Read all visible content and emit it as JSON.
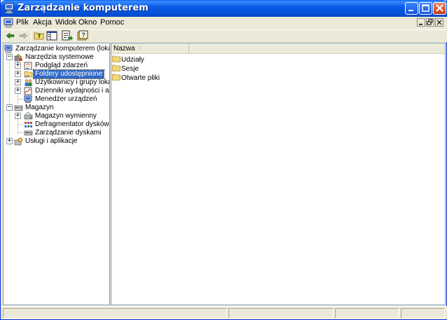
{
  "window": {
    "title": "Zarządzanie komputerem"
  },
  "menu": {
    "items": [
      "Plik",
      "Akcja",
      "Widok",
      "Okno",
      "Pomoc"
    ]
  },
  "toolbar": {
    "buttons": [
      "back-arrow-icon",
      "forward-arrow-icon",
      "up-folder-icon",
      "show-hide-tree-icon",
      "export-list-icon",
      "help-icon"
    ]
  },
  "tree": {
    "root": "Zarządzanie komputerem (lokalne)",
    "items": [
      {
        "label": "Narzędzia systemowe",
        "expander": "−"
      },
      {
        "label": "Podgląd zdarzeń",
        "expander": "+"
      },
      {
        "label": "Foldery udostępnione",
        "expander": "+"
      },
      {
        "label": "Użytkownicy i grupy lokalne",
        "expander": "+"
      },
      {
        "label": "Dzienniki wydajności i alerty",
        "expander": "+"
      },
      {
        "label": "Menedżer urządzeń",
        "expander": ""
      },
      {
        "label": "Magazyn",
        "expander": "−"
      },
      {
        "label": "Magazyn wymienny",
        "expander": "+"
      },
      {
        "label": "Defragmentator dysków",
        "expander": ""
      },
      {
        "label": "Zarządzanie dyskami",
        "expander": ""
      },
      {
        "label": "Usługi i aplikacje",
        "expander": "+"
      }
    ],
    "root_expander": "−",
    "selected": "Foldery udostępnione"
  },
  "list": {
    "columns": [
      "Nazwa"
    ],
    "sort_indicator": "/",
    "rows": [
      "Udziały",
      "Sesje",
      "Otwarte pliki"
    ]
  },
  "colors": {
    "selection": "#316ac5",
    "titlebar": "#0a5ae8",
    "folder": "#f5d774"
  }
}
